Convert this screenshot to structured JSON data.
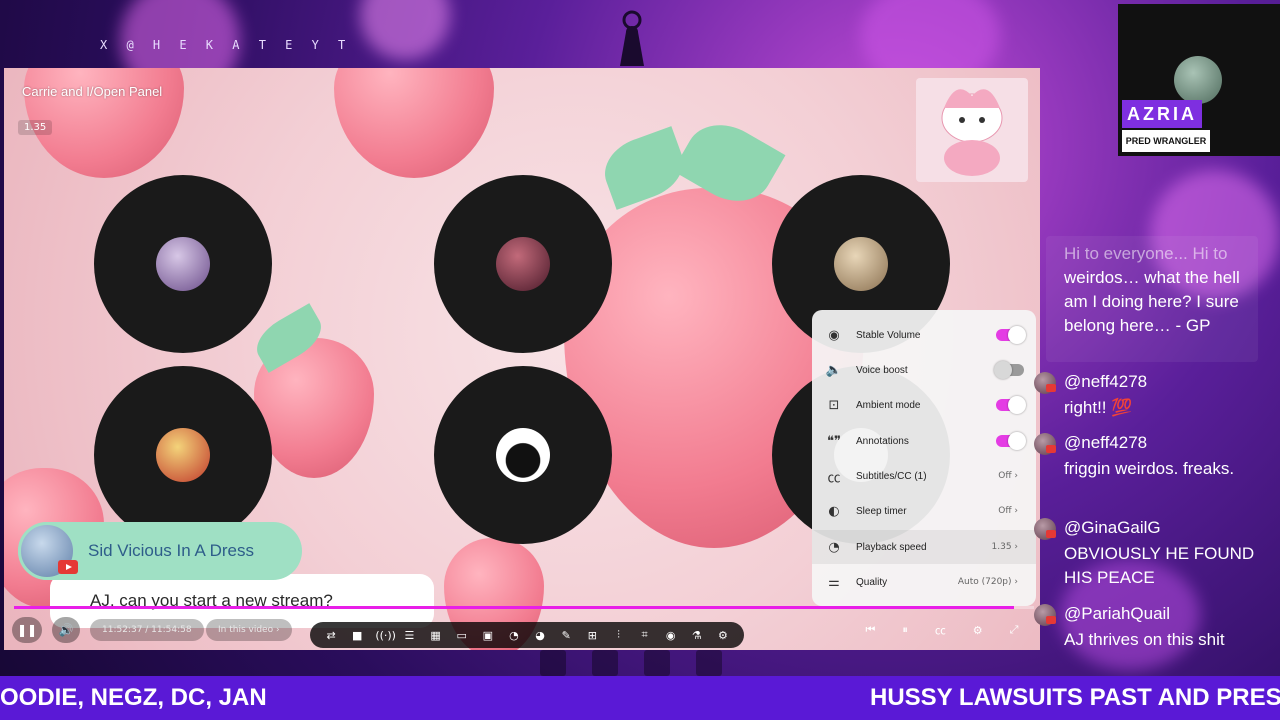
{
  "overlay": {
    "handle": "X @ H E K A T E Y T",
    "ticker_left": "OODIE, NEGZ, DC, JAN",
    "ticker_right": "HUSSY LAWSUITS PAST AND PRESENT A"
  },
  "stage": {
    "panel_title": "Carrie and I/Open Panel",
    "badge": "1.35",
    "speaker_name": "Sid Vicious In A Dress",
    "caption": "AJ, can you start a new stream?",
    "progress_fraction": 0.98
  },
  "player": {
    "time": "11:52:37 / 11:54:58",
    "chapter": "In this video ›",
    "play_pause_icon": "pause-icon",
    "volume_icon": "volume-icon"
  },
  "settings_menu": {
    "items": [
      {
        "icon": "stable-volume-icon",
        "label": "Stable Volume",
        "type": "toggle",
        "on": true
      },
      {
        "icon": "voice-boost-icon",
        "label": "Voice boost",
        "type": "toggle",
        "on": false
      },
      {
        "icon": "ambient-mode-icon",
        "label": "Ambient mode",
        "type": "toggle",
        "on": true
      },
      {
        "icon": "annotations-icon",
        "label": "Annotations",
        "type": "toggle",
        "on": true
      },
      {
        "icon": "subtitles-icon",
        "label": "Subtitles/CC (1)",
        "type": "value",
        "value": "Off ›"
      },
      {
        "icon": "sleep-timer-icon",
        "label": "Sleep timer",
        "type": "value",
        "value": "Off ›"
      },
      {
        "icon": "playback-speed-icon",
        "label": "Playback speed",
        "type": "value",
        "value": "1.35 ›"
      },
      {
        "icon": "quality-icon",
        "label": "Quality",
        "type": "value",
        "value": "Auto (720p) ›"
      }
    ]
  },
  "streamer": {
    "name": "AZRIA",
    "role": "PRED WRANGLER"
  },
  "chat": {
    "faded": {
      "text": "Hi to everyone... Hi to ",
      "text_solid": "weirdos… what the hell am I doing here? I sure belong here… - GP"
    },
    "messages": [
      {
        "user": "@neff4278",
        "text": "right!! 💯"
      },
      {
        "user": "@neff4278",
        "text": "friggin weirdos. freaks."
      },
      {
        "user": "@GinaGailG",
        "text": "OBVIOUSLY HE FOUND HIS PEACE"
      },
      {
        "user": "@PariahQuail",
        "text": "AJ thrives on this shit"
      }
    ]
  },
  "colors": {
    "accent": "#e81ee8",
    "ticker_bg": "#5a19d6",
    "name_pill": "#9fe0c4"
  }
}
